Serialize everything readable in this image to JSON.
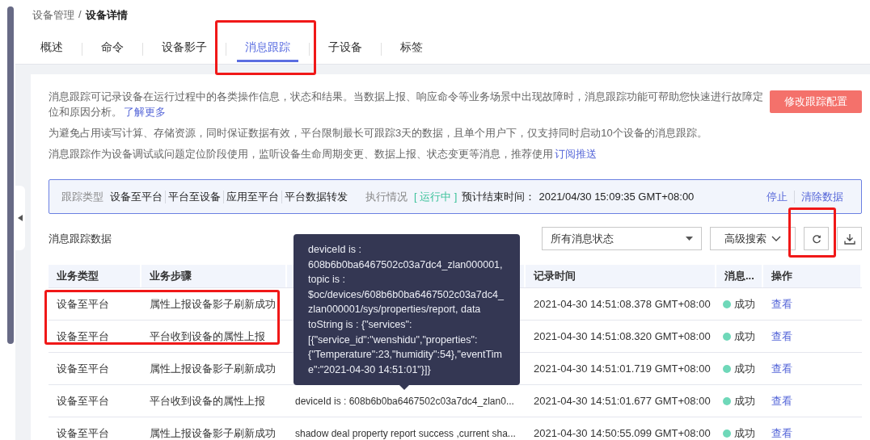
{
  "breadcrumb": {
    "parent": "设备管理",
    "separator": "/",
    "current": "设备详情"
  },
  "tabs": [
    {
      "label": "概述",
      "selected": false
    },
    {
      "label": "命令",
      "selected": false
    },
    {
      "label": "设备影子",
      "selected": false
    },
    {
      "label": "消息跟踪",
      "selected": true
    },
    {
      "label": "子设备",
      "selected": false
    },
    {
      "label": "标签",
      "selected": false
    }
  ],
  "notes": [
    {
      "text": "消息跟踪可记录设备在运行过程中的各类操作信息，状态和结果。当数据上报、响应命令等业务场景中出现故障时，消息跟踪功能可帮助您快速进行故障定位和原因分析。",
      "link": "了解更多"
    },
    {
      "text": "为避免占用读写计算、存储资源，同时保证数据有效，平台限制最长可跟踪3天的数据，且单个用户下，仅支持同时启动10个设备的消息跟踪。"
    },
    {
      "text": "消息跟踪作为设备调试或问题定位阶段使用，监听设备生命周期变更、数据上报、状态变更等消息，推荐使用",
      "link": "订阅推送"
    }
  ],
  "config_button": "修改跟踪配置",
  "trace_info": {
    "type_label": "跟踪类型",
    "types": [
      "设备至平台",
      "平台至设备",
      "应用至平台",
      "平台数据转发"
    ],
    "status_label": "执行情况",
    "status": "[ 运行中 ]",
    "end_label": "预计结束时间：",
    "end_time": "2021/04/30 15:09:35 GMT+08:00",
    "actions": [
      "停止",
      "清除数据"
    ]
  },
  "data_title": "消息跟踪数据",
  "status_filter": "所有消息状态",
  "advanced_search": "高级搜索",
  "annotation_frames": [
    {
      "kind": "tab"
    },
    {
      "kind": "refresh"
    },
    {
      "kind": "rows"
    }
  ],
  "columns": [
    {
      "label": "业务类型"
    },
    {
      "label": "业务步骤"
    },
    {},
    {
      "label": "记录时间"
    },
    {
      "label": "消息..."
    },
    {
      "label": "操作"
    }
  ],
  "rows": [
    {
      "type": "设备至平台",
      "step": "属性上报设备影子刷新成功",
      "time": "2021-04-30 14:51:08.378 GMT+08:00",
      "status": "成功",
      "action": "查看"
    },
    {
      "type": "设备至平台",
      "step": "平台收到设备的属性上报",
      "time": "2021-04-30 14:51:08.320 GMT+08:00",
      "status": "成功",
      "action": "查看"
    },
    {
      "type": "设备至平台",
      "step": "属性上报设备影子刷新成功",
      "time": "2021-04-30 14:51:01.719 GMT+08:00",
      "status": "成功",
      "action": "查看"
    },
    {
      "type": "设备至平台",
      "step": "平台收到设备的属性上报",
      "content": "deviceId is : 608b6b0ba6467502c03a7dc4_zlan0...",
      "time": "2021-04-30 14:51:01.677 GMT+08:00",
      "status": "成功",
      "action": "查看"
    },
    {
      "type": "设备至平台",
      "step": "属性上报设备影子刷新成功",
      "content": "shadow deal property report success ,current sha...",
      "time": "2021-04-30 14:50:55.099 GMT+08:00",
      "status": "成功",
      "action": "查看"
    }
  ],
  "tooltip": "deviceId is : 608b6b0ba6467502c03a7dc4_zlan000001, topic is : $oc/devices/608b6b0ba6467502c03a7dc4_zlan000001/sys/properties/report, data toString is : {\"services\":[{\"service_id\":\"wenshidu\",\"properties\":{\"Temperature\":23,\"humidity\":54},\"eventTime\":\"2021-04-30 14:51:01\"}]}"
}
